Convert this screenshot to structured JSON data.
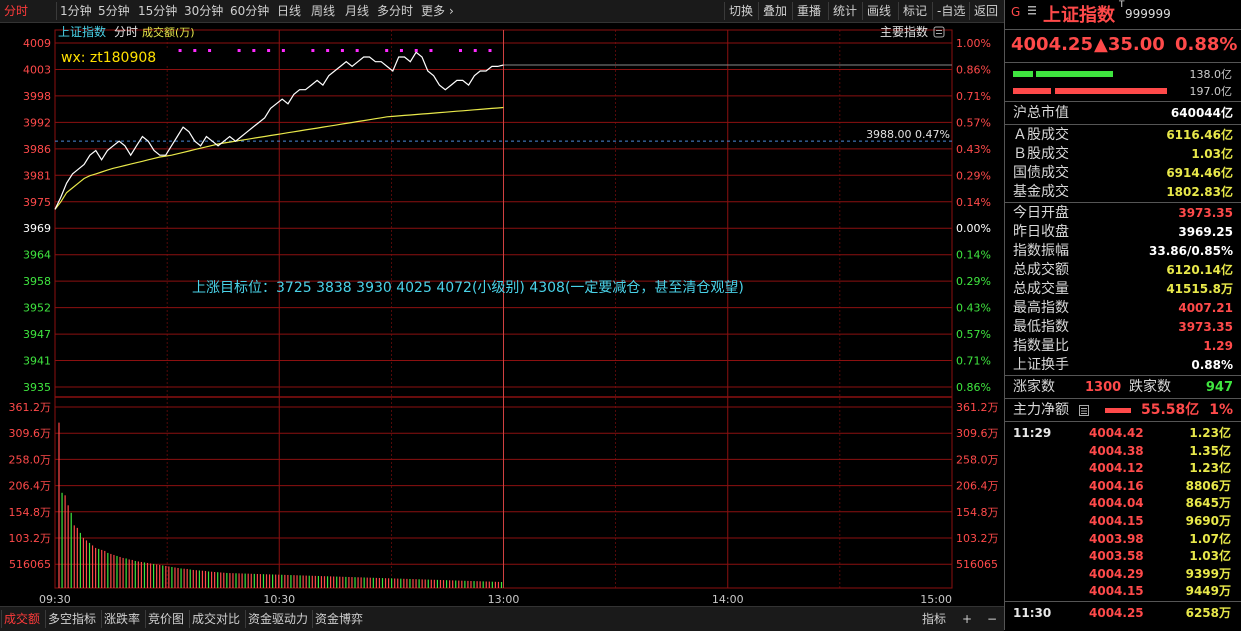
{
  "toolbar": {
    "left_items": [
      "分时",
      "1分钟",
      "5分钟",
      "15分钟",
      "30分钟",
      "60分钟",
      "日线",
      "周线",
      "月线",
      "多分时",
      "更多"
    ],
    "active_index": 0,
    "right_items": [
      "切换",
      "叠加",
      "重播",
      "统计",
      "画线",
      "标记",
      "-自选",
      "返回"
    ]
  },
  "chart": {
    "index_name_label": "上证指数",
    "mode_label": "分时",
    "volume_label": "成交额(万)",
    "main_indicator_label": "主要指数",
    "watermark": "wx: zt180908",
    "annotation": "上涨目标位：3725  3838  3930  4025  4072(小级别)  4308(一定要减仓，甚至清仓观望)",
    "crosshair_label": "3988.00 0.47%",
    "crosshair_price": 3988.0,
    "y_price_ticks": [
      "4009",
      "4003",
      "3998",
      "3992",
      "3986",
      "3981",
      "3975",
      "3969",
      "3964",
      "3958",
      "3952",
      "3947",
      "3941",
      "3935"
    ],
    "y_price_values": [
      4009.0,
      4003.4,
      3997.7,
      3992.1,
      3986.4,
      3980.8,
      3975.1,
      3969.25,
      3963.6,
      3958.0,
      3952.3,
      3946.7,
      3941.0,
      3935.4
    ],
    "y_pct_ticks": [
      "1.00%",
      "0.86%",
      "0.71%",
      "0.57%",
      "0.43%",
      "0.29%",
      "0.14%",
      "0.00%",
      "0.14%",
      "0.29%",
      "0.43%",
      "0.57%",
      "0.71%",
      "0.86%"
    ],
    "y_vol_ticks": [
      "361.2万",
      "309.6万",
      "258.0万",
      "206.4万",
      "154.8万",
      "103.2万",
      "516065"
    ],
    "y_vol_values": [
      3612000,
      3096000,
      2580000,
      2064000,
      1548000,
      1032000,
      516065
    ],
    "x_ticks": [
      "09:30",
      "10:30",
      "13:00",
      "14:00",
      "15:00"
    ],
    "prev_close": 3969.25,
    "price_min": 3935.4,
    "price_max": 4009.0,
    "price_series": [
      3973.4,
      3976,
      3979,
      3981,
      3982,
      3983,
      3985,
      3986,
      3984,
      3986,
      3987,
      3988,
      3987,
      3985,
      3987,
      3989,
      3988,
      3986,
      3985,
      3985,
      3987,
      3989,
      3991,
      3990,
      3988,
      3987,
      3989,
      3988,
      3987,
      3988,
      3989,
      3988,
      3989,
      3990,
      3991,
      3992,
      3993,
      3995,
      3996,
      3997,
      3996,
      3998,
      3999,
      3999,
      4000,
      4001,
      4000,
      4002,
      4003,
      4004,
      4005,
      4004,
      4005,
      4006,
      4006,
      4005,
      4005,
      4004,
      4003,
      4006,
      4006,
      4005,
      4007,
      4006,
      4003,
      4002,
      4000,
      3999,
      4000,
      4001,
      4001,
      4000,
      4002,
      4003,
      4003,
      4004,
      4004,
      4004.3
    ],
    "avg_series": [
      3973.4,
      3975,
      3977,
      3978,
      3979,
      3980,
      3980.6,
      3981,
      3981.4,
      3981.8,
      3982.2,
      3982.5,
      3982.8,
      3983.1,
      3983.4,
      3983.7,
      3984,
      3984.3,
      3984.6,
      3984.8,
      3985,
      3985.3,
      3985.6,
      3985.9,
      3986.2,
      3986.5,
      3986.8,
      3987.1,
      3987.4,
      3987.6,
      3987.8,
      3988,
      3988.2,
      3988.4,
      3988.6,
      3988.8,
      3989,
      3989.2,
      3989.4,
      3989.6,
      3989.8,
      3990,
      3990.2,
      3990.4,
      3990.6,
      3990.8,
      3991,
      3991.2,
      3991.4,
      3991.6,
      3991.8,
      3992,
      3992.2,
      3992.4,
      3992.6,
      3992.8,
      3993,
      3993.2,
      3993.3,
      3993.4,
      3993.5,
      3993.6,
      3993.7,
      3993.8,
      3993.9,
      3994,
      3994.1,
      3994.2,
      3994.3,
      3994.4,
      3994.5,
      3994.6,
      3994.7,
      3994.8,
      3994.9,
      3995,
      3995.1,
      3995.2
    ],
    "volume_series": [
      3300000,
      1900000,
      1850000,
      1650000,
      1500000,
      1250000,
      1200000,
      1100000,
      1000000,
      950000,
      900000,
      850000,
      800000,
      780000,
      760000,
      740000,
      700000,
      680000,
      660000,
      640000,
      620000,
      600000,
      590000,
      570000,
      560000,
      540000,
      530000,
      520000,
      510000,
      500000,
      490000,
      480000,
      470000,
      460000,
      450000,
      440000,
      430000,
      420000,
      410000,
      400000,
      390000,
      385000,
      380000,
      370000,
      360000,
      355000,
      350000,
      345000,
      340000,
      330000,
      325000,
      320000,
      315000,
      310000,
      305000,
      300000,
      298000,
      296000,
      294000,
      292000,
      290000,
      288000,
      286000,
      284000,
      282000,
      280000,
      278000,
      276000,
      274000,
      272000,
      270000,
      268000,
      266000,
      264000,
      262000,
      260000,
      258000,
      256000,
      254000,
      252000,
      250000,
      248000,
      246000,
      244000,
      242000,
      240000,
      238000,
      236000,
      234000,
      232000,
      230000,
      228000,
      226000,
      224000,
      222000,
      220000,
      218000,
      216000,
      214000,
      212000,
      210000,
      208000,
      206000,
      204000,
      202000,
      200000,
      198000,
      196000,
      194000,
      192000,
      190000,
      188000,
      186000,
      184000,
      182000,
      180000,
      178000,
      176000,
      174000,
      172000,
      170000,
      168000,
      166000,
      164000,
      162000,
      160000,
      158000,
      156000,
      154000,
      152000,
      150000,
      148000,
      146000,
      144000,
      142000,
      140000,
      138000,
      136000,
      134000,
      132000,
      130000,
      128000,
      126000,
      124000,
      122000,
      120000
    ],
    "total_minutes": 240,
    "elapsed_minutes": 120,
    "colors": {
      "grid": "#8b1010",
      "price": "#ffffff",
      "avg": "#e8e84a",
      "up": "#ff4a4a",
      "down": "#3fe53f",
      "axis_green": "#3fe53f",
      "axis_red": "#ff4a4a",
      "annotation": "#4ad2e8",
      "magenta": "#ff2bff"
    }
  },
  "bottom_tabs": [
    "成交额",
    "多空指标",
    "涨跌率",
    "竞价图",
    "成交对比",
    "资金驱动力",
    "资金博弈"
  ],
  "bottom_right": [
    "指标",
    "+",
    "−"
  ],
  "panel": {
    "g_label": "G",
    "menu_icon": "menu-icon",
    "title": "上证指数",
    "title_sup": "T",
    "code": "999999",
    "price": "4004.25",
    "change": "▲35.00",
    "change_pct": "0.88%",
    "bar1_value": "138.0亿",
    "bar2_value": "197.0亿",
    "bar1_green_fraction": 0.3,
    "bar1_red_fraction": 0.67,
    "market_cap_label": "沪总市值",
    "market_cap_value": "640044亿",
    "turnover_rows": [
      {
        "label": "Ａ股成交",
        "value": "6116.46亿"
      },
      {
        "label": "Ｂ股成交",
        "value": "1.03亿"
      },
      {
        "label": "国债成交",
        "value": "6914.46亿"
      },
      {
        "label": "基金成交",
        "value": "1802.83亿"
      }
    ],
    "stat_rows": [
      {
        "label": "今日开盘",
        "value": "3973.35",
        "color": "red"
      },
      {
        "label": "昨日收盘",
        "value": "3969.25",
        "color": "white"
      },
      {
        "label": "指数振幅",
        "value": "33.86/0.85%",
        "color": "white"
      },
      {
        "label": "总成交额",
        "value": "6120.14亿",
        "color": "yellow"
      },
      {
        "label": "总成交量",
        "value": "41515.8万",
        "color": "yellow"
      },
      {
        "label": "最高指数",
        "value": "4007.21",
        "color": "red"
      },
      {
        "label": "最低指数",
        "value": "3973.35",
        "color": "red"
      },
      {
        "label": "指数量比",
        "value": "1.29",
        "color": "red"
      },
      {
        "label": "上证换手",
        "value": "0.88%",
        "color": "white"
      }
    ],
    "up_label": "涨家数",
    "up_value": "1300",
    "down_label": "跌家数",
    "down_value": "947",
    "main_flow_label": "主力净额",
    "main_flow_value": "55.58亿",
    "main_flow_pct": "1%",
    "ticks_time_1": "11:29",
    "ticks": [
      {
        "price": "4004.42",
        "vol": "1.23亿"
      },
      {
        "price": "4004.38",
        "vol": "1.35亿"
      },
      {
        "price": "4004.12",
        "vol": "1.23亿"
      },
      {
        "price": "4004.16",
        "vol": "8806万"
      },
      {
        "price": "4004.04",
        "vol": "8645万"
      },
      {
        "price": "4004.15",
        "vol": "9690万"
      },
      {
        "price": "4003.98",
        "vol": "1.07亿"
      },
      {
        "price": "4003.58",
        "vol": "1.03亿"
      },
      {
        "price": "4004.29",
        "vol": "9399万"
      },
      {
        "price": "4004.15",
        "vol": "9449万"
      }
    ],
    "last_time": "11:30",
    "last_price": "4004.25",
    "last_vol": "6258万"
  }
}
